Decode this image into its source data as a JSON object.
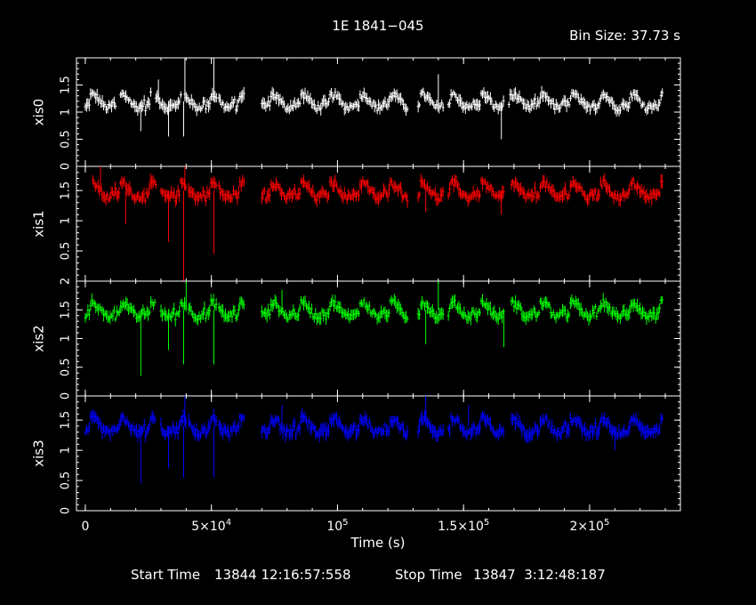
{
  "chart_data": {
    "type": "line",
    "title": "1E 1841−045",
    "subtitle": "Bin Size: 37.73 s",
    "xlabel": "Time (s)",
    "x_ticks": [
      {
        "value": 0,
        "label": "0"
      },
      {
        "value": 50000,
        "label": "5×10",
        "exp": "4"
      },
      {
        "value": 100000,
        "label": "10",
        "exp": "5"
      },
      {
        "value": 150000,
        "label": "1.5×10",
        "exp": "5"
      },
      {
        "value": 200000,
        "label": "2×10",
        "exp": "5"
      }
    ],
    "xlim": [
      -3500,
      236000
    ],
    "footer": {
      "start_label": "Start Time",
      "start_value": "13844 12:16:57:558",
      "stop_label": "Stop Time",
      "stop_value": "13847  3:12:48:187"
    },
    "panels": [
      {
        "name": "xis0",
        "color": "#ffffff",
        "ylim": [
          0,
          2
        ],
        "yticks": [
          "0",
          "0.5",
          "1",
          "1.5"
        ],
        "ytick_values": [
          0,
          0.5,
          1,
          1.5
        ],
        "baseline": 1.2,
        "segments": [
          [
            0,
            12000
          ],
          [
            14000,
            26000
          ],
          [
            28000,
            38000
          ],
          [
            39500,
            52000
          ],
          [
            53000,
            63000
          ],
          [
            70000,
            128000
          ],
          [
            132000,
            142000
          ],
          [
            144000,
            166000
          ],
          [
            168000,
            229000
          ]
        ],
        "spikes": [
          {
            "x": 22000,
            "y": 0.65
          },
          {
            "x": 33000,
            "y": 0.55
          },
          {
            "x": 39000,
            "y": 0.55
          },
          {
            "x": 39500,
            "y": 2.0
          },
          {
            "x": 51000,
            "y": 2.0
          },
          {
            "x": 29000,
            "y": 1.6
          },
          {
            "x": 140000,
            "y": 1.7
          },
          {
            "x": 165000,
            "y": 0.5
          }
        ]
      },
      {
        "name": "xis1",
        "color": "#ff0000",
        "ylim": [
          0,
          1.9
        ],
        "yticks": [
          "0.5",
          "1",
          "1.5"
        ],
        "ytick_values": [
          0.5,
          1,
          1.5
        ],
        "baseline": 1.5,
        "segments": [
          [
            3000,
            28000
          ],
          [
            30000,
            40000
          ],
          [
            41000,
            52000
          ],
          [
            53000,
            63000
          ],
          [
            70000,
            128000
          ],
          [
            132000,
            142000
          ],
          [
            144000,
            166000
          ],
          [
            169000,
            229000
          ]
        ],
        "spikes": [
          {
            "x": 16000,
            "y": 0.95
          },
          {
            "x": 33000,
            "y": 0.65
          },
          {
            "x": 39000,
            "y": 0.0
          },
          {
            "x": 39500,
            "y": 1.9
          },
          {
            "x": 51000,
            "y": 0.45
          },
          {
            "x": 135000,
            "y": 1.15
          },
          {
            "x": 165000,
            "y": 1.1
          },
          {
            "x": 6000,
            "y": 1.9
          }
        ]
      },
      {
        "name": "xis2",
        "color": "#00ff00",
        "ylim": [
          0,
          2
        ],
        "yticks": [
          "0",
          "0.5",
          "1",
          "1.5",
          "2"
        ],
        "ytick_values": [
          0,
          0.5,
          1,
          1.5,
          2
        ],
        "baseline": 1.5,
        "segments": [
          [
            0,
            28000
          ],
          [
            30000,
            40000
          ],
          [
            41000,
            52000
          ],
          [
            53000,
            63000
          ],
          [
            70000,
            128000
          ],
          [
            132000,
            142000
          ],
          [
            144000,
            166000
          ],
          [
            169000,
            229000
          ]
        ],
        "spikes": [
          {
            "x": 22000,
            "y": 0.35
          },
          {
            "x": 33000,
            "y": 0.8
          },
          {
            "x": 39000,
            "y": 0.55
          },
          {
            "x": 40000,
            "y": 2.0
          },
          {
            "x": 51000,
            "y": 0.55
          },
          {
            "x": 135000,
            "y": 0.9
          },
          {
            "x": 140000,
            "y": 2.0
          },
          {
            "x": 166000,
            "y": 0.85
          },
          {
            "x": 78000,
            "y": 1.85
          }
        ]
      },
      {
        "name": "xis3",
        "color": "#0000ff",
        "ylim": [
          0,
          1.9
        ],
        "yticks": [
          "0",
          "0.5",
          "1",
          "1.5"
        ],
        "ytick_values": [
          0,
          0.5,
          1,
          1.5
        ],
        "baseline": 1.4,
        "segments": [
          [
            0,
            28000
          ],
          [
            30000,
            40000
          ],
          [
            41000,
            52000
          ],
          [
            53000,
            63000
          ],
          [
            70000,
            128000
          ],
          [
            132000,
            142000
          ],
          [
            144000,
            166000
          ],
          [
            169000,
            229000
          ]
        ],
        "spikes": [
          {
            "x": 22000,
            "y": 0.45
          },
          {
            "x": 33000,
            "y": 0.7
          },
          {
            "x": 39000,
            "y": 0.55
          },
          {
            "x": 39500,
            "y": 1.9
          },
          {
            "x": 51000,
            "y": 0.55
          },
          {
            "x": 135000,
            "y": 1.9
          },
          {
            "x": 152000,
            "y": 1.75
          },
          {
            "x": 78000,
            "y": 1.75
          },
          {
            "x": 210000,
            "y": 1.0
          }
        ]
      }
    ]
  }
}
